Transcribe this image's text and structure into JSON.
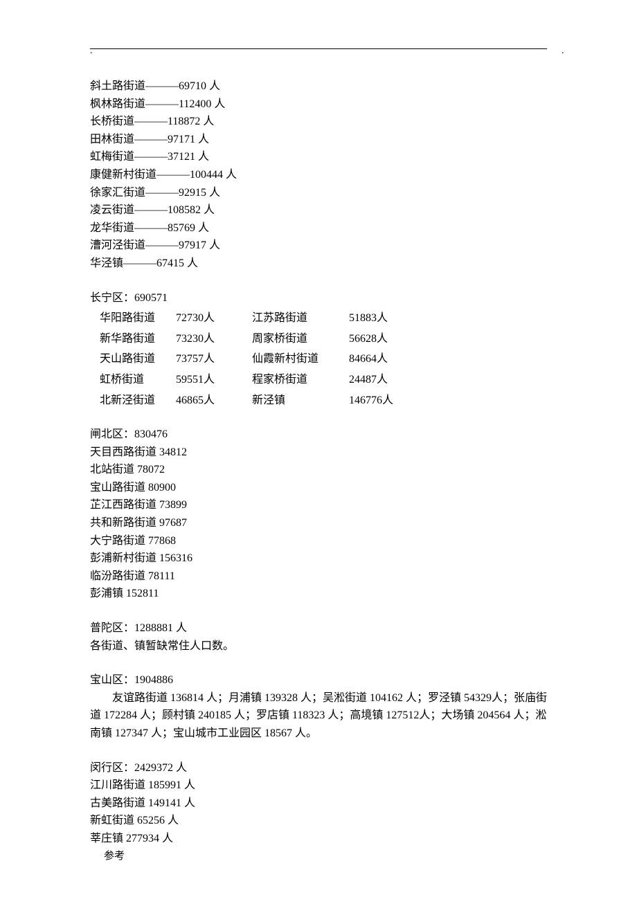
{
  "header_dots": ".   .   .       .",
  "xuhui": {
    "items": [
      {
        "name": "斜土路街道",
        "sep": "———",
        "value": "69710 人"
      },
      {
        "name": "枫林路街道",
        "sep": "———",
        "value": "112400 人"
      },
      {
        "name": "长桥街道",
        "sep": "———",
        "value": "118872 人"
      },
      {
        "name": "田林街道",
        "sep": "———",
        "value": "97171 人"
      },
      {
        "name": "虹梅街道",
        "sep": "———",
        "value": "37121 人"
      },
      {
        "name": "康健新村街道",
        "sep": "———",
        "value": "100444 人"
      },
      {
        "name": "徐家汇街道",
        "sep": "———",
        "value": "92915 人"
      },
      {
        "name": "凌云街道",
        "sep": "———",
        "value": "108582 人"
      },
      {
        "name": "龙华街道",
        "sep": "———",
        "value": "85769 人"
      },
      {
        "name": "漕河泾街道",
        "sep": "———",
        "value": "97917 人"
      },
      {
        "name": "华泾镇",
        "sep": "———",
        "value": "67415 人"
      }
    ]
  },
  "changning": {
    "title": "长宁区：690571",
    "rows": [
      {
        "c1": "华阳路街道",
        "c2": "72730人",
        "c3": "江苏路街道",
        "c4": "51883人"
      },
      {
        "c1": "新华路街道",
        "c2": "73230人",
        "c3": "周家桥街道",
        "c4": "56628人"
      },
      {
        "c1": "天山路街道",
        "c2": "73757人",
        "c3": "仙霞新村街道",
        "c4": "84664人"
      },
      {
        "c1": "虹桥街道",
        "c2": "59551人",
        "c3": "程家桥街道",
        "c4": "24487人"
      },
      {
        "c1": "北新泾街道",
        "c2": "46865人",
        "c3": "新泾镇",
        "c4": "146776人"
      }
    ]
  },
  "zhabei": {
    "title": "闸北区：830476",
    "items": [
      "天目西路街道 34812",
      "北站街道 78072",
      "宝山路街道 80900",
      "芷江西路街道 73899",
      "共和新路街道 97687",
      "大宁路街道 77868",
      "彭浦新村街道 156316",
      "临汾路街道 78111",
      "彭浦镇 152811"
    ]
  },
  "putuo": {
    "title": "普陀区：1288881 人",
    "note": "各街道、镇暂缺常住人口数。"
  },
  "baoshan": {
    "title": "宝山区：1904886",
    "para": "友谊路街道 136814 人；月浦镇 139328 人；吴淞街道 104162 人；罗泾镇 54329人；张庙街道 172284 人；顾村镇 240185 人；罗店镇 118323 人；高境镇 127512人；大场镇 204564 人；淞南镇 127347 人；宝山城市工业园区 18567 人。"
  },
  "minhang": {
    "title": "闵行区：2429372 人",
    "items": [
      "江川路街道  185991 人",
      "古美路街道  149141 人",
      "新虹街道  65256 人",
      "莘庄镇  277934 人"
    ]
  },
  "footer": "参考"
}
